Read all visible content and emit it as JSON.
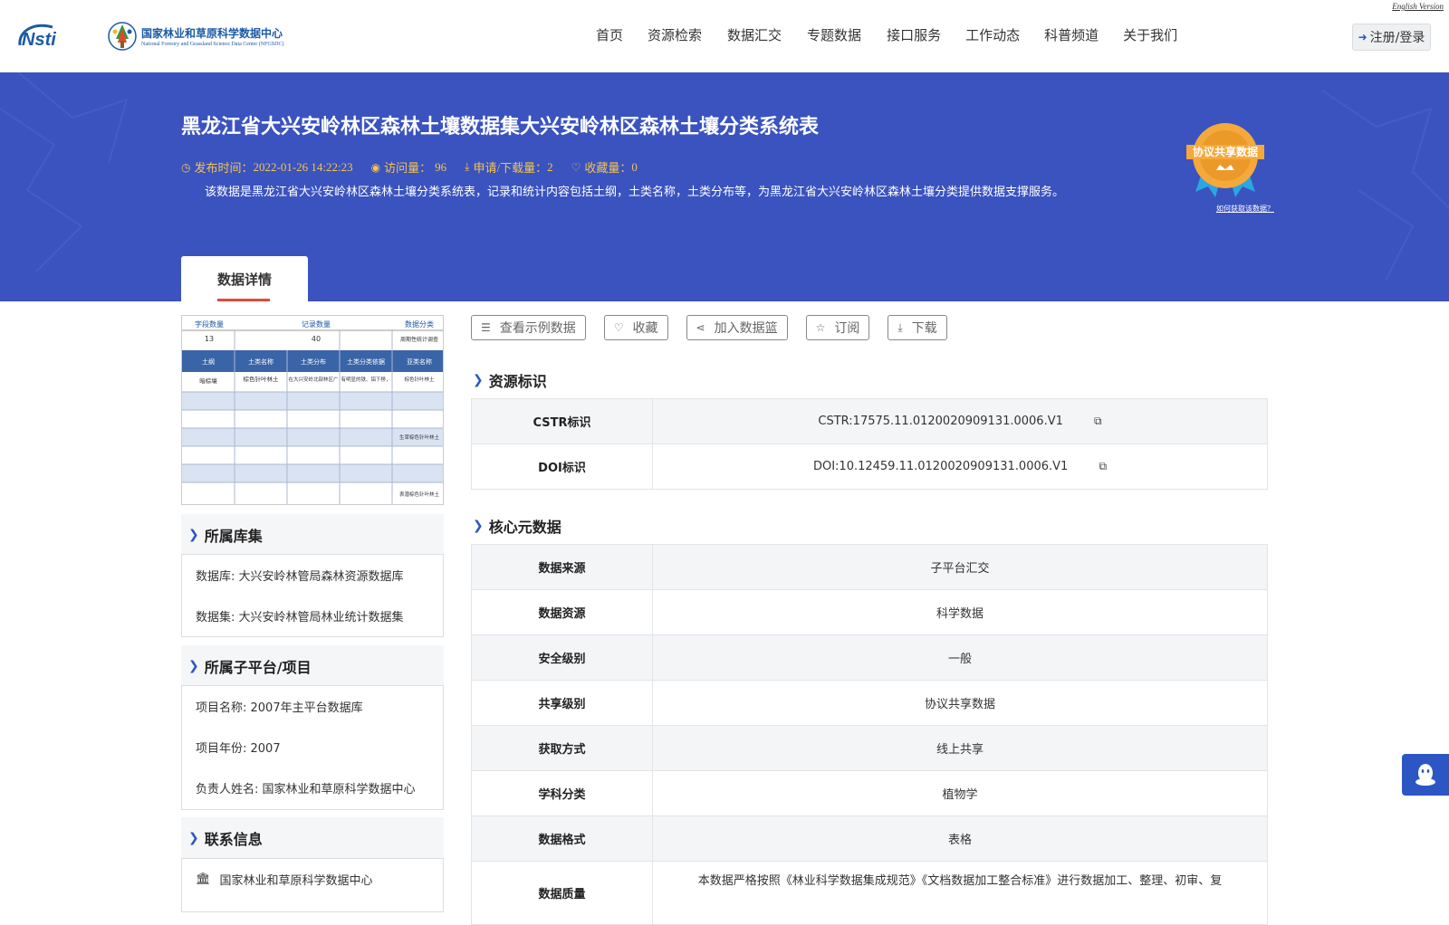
{
  "header": {
    "english_link": "English Version",
    "logo_cn": "国家林业和草原科学数据中心",
    "logo_en": "National Forestry and Grassland Science Data Center (NFGSDC)",
    "logo_nsti": "Nsti",
    "nav": [
      "首页",
      "资源检索",
      "数据汇交",
      "专题数据",
      "接口服务",
      "工作动态",
      "科普频道",
      "关于我们"
    ],
    "login": "注册/登录"
  },
  "banner": {
    "title": "黑龙江省大兴安岭林区森林土壤数据集大兴安岭林区森林土壤分类系统表",
    "publish_label": "发布时间：",
    "publish_time": "2022-01-26 14:22:23",
    "views_label": "访问量：",
    "views": "96",
    "downloads_label": "申请/下载量：",
    "downloads": "2",
    "favorites_label": "收藏量：",
    "favorites": "0",
    "description": "该数据是黑龙江省大兴安岭林区森林土壤分类系统表，记录和统计内容包括土纲，土类名称，土类分布等，为黑龙江省大兴安岭林区森林土壤分类提供数据支撑服务。",
    "badge_text": "协议共享数据",
    "badge_link": "如何获取该数据？",
    "tab": "数据详情"
  },
  "thumbnail": {
    "h1": "字段数量",
    "h2": "记录数量",
    "h3": "数据分类",
    "v1": "13",
    "v2": "40",
    "v3": "周期性统计调查",
    "cols": [
      "土纲",
      "土类名称",
      "土类分布",
      "土类分类依据",
      "亚类名称"
    ],
    "r1": [
      "暗棕壤",
      "棕色针叶林土",
      "在大兴安岭北部林区广",
      "有明显的铁、铝下移，",
      "棕色针叶林土"
    ],
    "r2e": "生草棕色针叶林土",
    "r3e": "表潜棕色针叶林土"
  },
  "left": {
    "library_title": "所属库集",
    "library_rows": [
      "数据库: 大兴安岭林管局森林资源数据库",
      "数据集: 大兴安岭林管局林业统计数据集"
    ],
    "project_title": "所属子平台/项目",
    "project_rows": [
      "项目名称: 2007年主平台数据库",
      "项目年份: 2007",
      "负责人姓名: 国家林业和草原科学数据中心"
    ],
    "contact_title": "联系信息",
    "contact_org": "国家林业和草原科学数据中心"
  },
  "actions": [
    "查看示例数据",
    "收藏",
    "加入数据篮",
    "订阅",
    "下载"
  ],
  "resource_id": {
    "title": "资源标识",
    "rows": [
      {
        "k": "CSTR标识",
        "v": "CSTR:17575.11.0120020909131.0006.V1"
      },
      {
        "k": "DOI标识",
        "v": "DOI:10.12459.11.0120020909131.0006.V1"
      }
    ]
  },
  "core": {
    "title": "核心元数据",
    "rows": [
      {
        "k": "数据来源",
        "v": "子平台汇交"
      },
      {
        "k": "数据资源",
        "v": "科学数据"
      },
      {
        "k": "安全级别",
        "v": "一般"
      },
      {
        "k": "共享级别",
        "v": "协议共享数据"
      },
      {
        "k": "获取方式",
        "v": "线上共享"
      },
      {
        "k": "学科分类",
        "v": "植物学"
      },
      {
        "k": "数据格式",
        "v": "表格"
      },
      {
        "k": "数据质量",
        "v": "本数据严格按照《林业科学数据集成规范》《文档数据加工整合标准》进行数据加工、整理、初审、复"
      }
    ]
  },
  "colors": {
    "banner": "#3a53bf",
    "accent": "#2b56c4",
    "meta": "#f5c451",
    "tab_underline": "#e14a3a"
  }
}
